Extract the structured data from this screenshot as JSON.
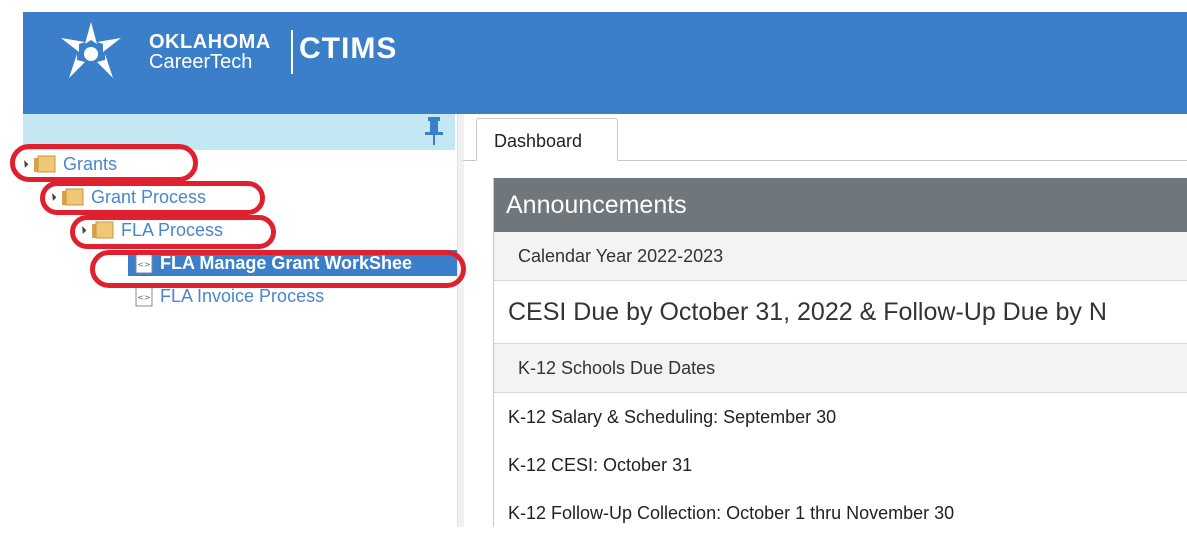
{
  "header": {
    "brand_line1": "OKLAHOMA",
    "brand_line2": "CareerTech",
    "app_name": "CTIMS",
    "bg_color": "#3b7fcb"
  },
  "sidebar": {
    "pin_icon": "pin-icon",
    "tree": [
      {
        "label": "Grants",
        "icon": "folder-icon",
        "expanded": true
      },
      {
        "label": "Grant Process",
        "icon": "folder-icon",
        "expanded": true
      },
      {
        "label": "FLA Process",
        "icon": "folder-icon",
        "expanded": true
      },
      {
        "label": "FLA Manage Grant WorkShee",
        "icon": "page-icon",
        "selected": true
      },
      {
        "label": "FLA Invoice Process",
        "icon": "page-icon",
        "selected": false
      }
    ],
    "annotation_color": "#e0202e"
  },
  "tabs": [
    {
      "label": "Dashboard",
      "active": true
    }
  ],
  "announcements": {
    "title": "Announcements",
    "calendar_label": "Calendar Year 2022-2023",
    "headline": "CESI Due by October 31, 2022 & Follow-Up Due by N",
    "k12_label": "K-12 Schools Due Dates",
    "items": [
      "K-12 Salary & Scheduling: September 30",
      "K-12 CESI: October 31",
      "K-12 Follow-Up Collection: October 1 thru November 30"
    ]
  }
}
